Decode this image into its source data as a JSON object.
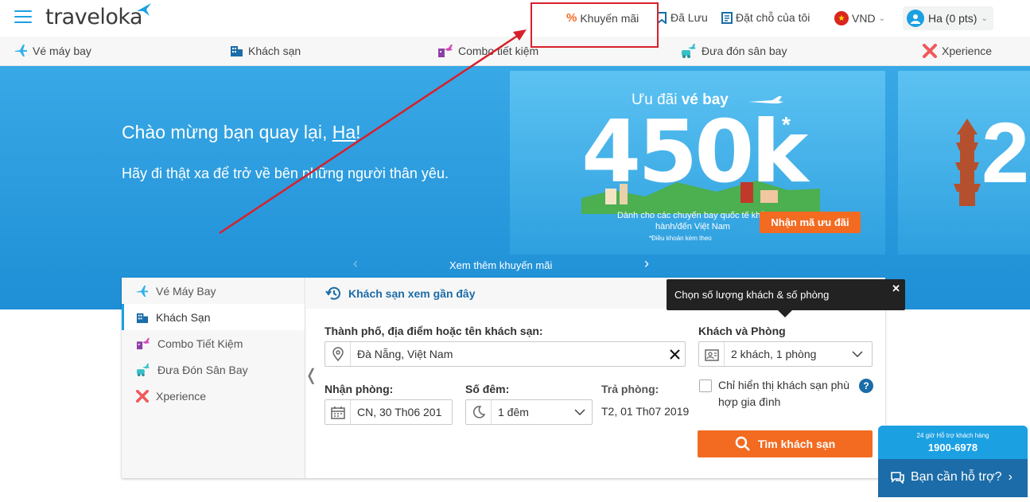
{
  "header": {
    "logo_text": "traveloka",
    "promo_icon": "%",
    "promo_label": "Khuyến mãi",
    "saved_label": "Đã Lưu",
    "bookings_label": "Đặt chỗ của tôi",
    "currency_label": "VND",
    "user_label": "Ha (0 pts)"
  },
  "products": [
    {
      "label": "Vé máy bay",
      "icon": "plane-icon"
    },
    {
      "label": "Khách sạn",
      "icon": "hotel-icon"
    },
    {
      "label": "Combo tiết kiệm",
      "icon": "combo-icon"
    },
    {
      "label": "Đưa đón sân bay",
      "icon": "airport-transfer-icon"
    },
    {
      "label": "Xperience",
      "icon": "xperience-icon"
    }
  ],
  "hero": {
    "welcome_prefix": "Chào mừng bạn quay lại, ",
    "welcome_name": "Ha",
    "welcome_suffix": "!",
    "tagline": "Hãy đi thật xa để trở về bên những người thân yêu.",
    "more_promos": "Xem thêm khuyến mãi"
  },
  "banner": {
    "title_light": "Ưu đãi ",
    "title_bold": "vé bay",
    "big_value": "450k",
    "star": "*",
    "description": "Dành cho các chuyến bay quốc tế khởi hành/đến Việt Nam",
    "note": "*Điều khoản kèm theo",
    "button_label": "Nhận mã ưu đãi",
    "next_banner_value": "2"
  },
  "side_menu": [
    {
      "label": "Vé Máy Bay",
      "icon": "plane-icon",
      "active": false
    },
    {
      "label": "Khách Sạn",
      "icon": "hotel-icon",
      "active": true
    },
    {
      "label": "Combo Tiết Kiệm",
      "icon": "combo-icon",
      "active": false
    },
    {
      "label": "Đưa Đón Sân Bay",
      "icon": "airport-transfer-icon",
      "active": false
    },
    {
      "label": "Xperience",
      "icon": "xperience-icon",
      "active": false
    }
  ],
  "search": {
    "recent_label": "Khách sạn xem gần đây",
    "destination_label": "Thành phố, địa điểm hoặc tên khách sạn:",
    "destination_value": "Đà Nẵng, Việt Nam",
    "checkin_label": "Nhận phòng:",
    "checkin_value": "CN, 30 Th06 201",
    "nights_label": "Số đêm:",
    "nights_value": "1 đêm",
    "checkout_label": "Trả phòng:",
    "checkout_value": "T2, 01 Th07 2019",
    "guests_label": "Khách và Phòng",
    "guests_value": "2 khách, 1 phòng",
    "family_label": "Chỉ hiển thị khách sạn phù hợp gia đình",
    "help_icon": "?",
    "search_button": "Tìm khách sạn"
  },
  "tooltip": {
    "text": "Chọn số lượng khách & số phòng",
    "close": "✕"
  },
  "support": {
    "hours": "24 giờ Hỗ trợ khách hàng",
    "phone": "1900-6978",
    "ask": "Bạn cần hỗ trợ?"
  },
  "colors": {
    "brand_blue": "#1ba0e2",
    "dark_blue": "#1b6ca8",
    "orange": "#f26b21",
    "annotation_red": "#d8202a"
  }
}
